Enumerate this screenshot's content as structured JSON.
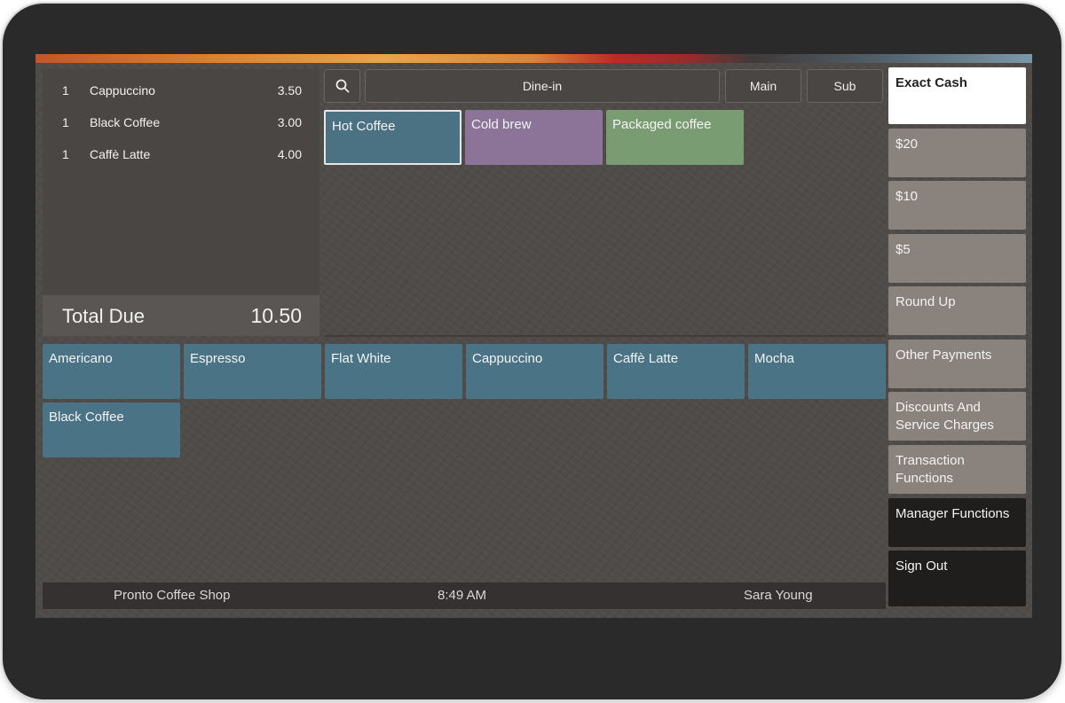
{
  "order": {
    "items": [
      {
        "qty": "1",
        "name": "Cappuccino",
        "price": "3.50"
      },
      {
        "qty": "1",
        "name": "Black Coffee",
        "price": "3.00"
      },
      {
        "qty": "1",
        "name": "Caffè Latte",
        "price": "4.00"
      }
    ],
    "total_label": "Total Due",
    "total_value": "10.50"
  },
  "topbar": {
    "search_icon": "search-icon",
    "order_type": "Dine-in",
    "main_label": "Main",
    "sub_label": "Sub"
  },
  "categories": [
    {
      "label": "Hot Coffee",
      "color": "#4b7282",
      "selected": true
    },
    {
      "label": "Cold brew",
      "color": "#8b7498"
    },
    {
      "label": "Packaged coffee",
      "color": "#7a9c72"
    }
  ],
  "menu_items": [
    "Americano",
    "Espresso",
    "Flat White",
    "Cappuccino",
    "Caffè Latte",
    "Mocha",
    "Black Coffee"
  ],
  "payments": {
    "exact_cash": "Exact Cash",
    "twenty": "$20",
    "ten": "$10",
    "five": "$5",
    "round_up": "Round Up",
    "other": "Other Payments",
    "discounts_line1": "Discounts And",
    "discounts_line2": "Service Charges",
    "transaction_line1": "Transaction",
    "transaction_line2": "Functions",
    "manager": "Manager Functions",
    "sign_out": "Sign Out"
  },
  "status": {
    "shop": "Pronto Coffee Shop",
    "time": "8:49 AM",
    "user": "Sara Young"
  }
}
